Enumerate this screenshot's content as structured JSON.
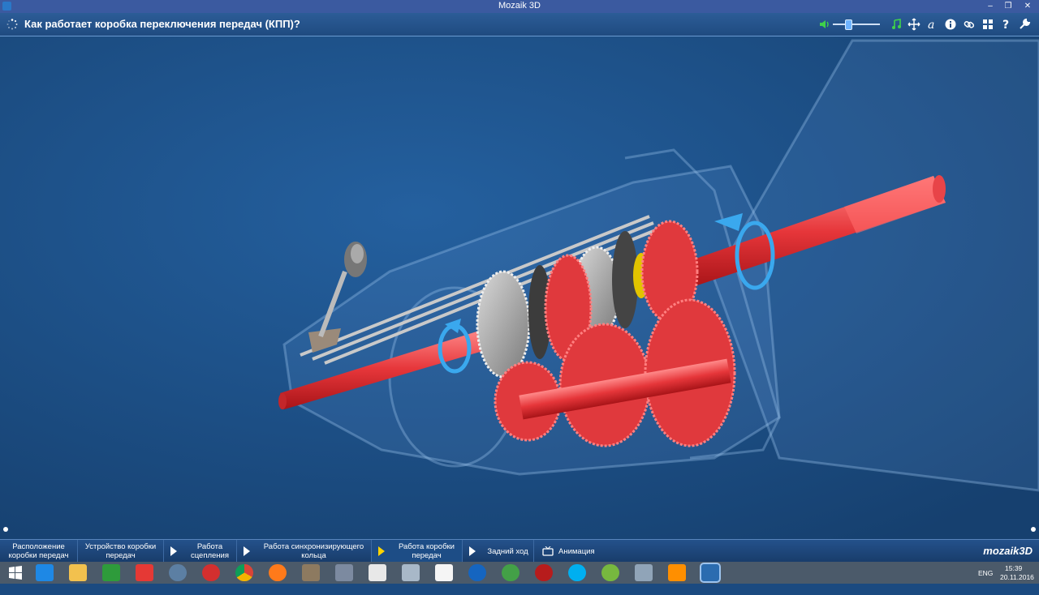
{
  "window": {
    "title": "Mozaik 3D",
    "controls": [
      "–",
      "❐",
      "✕"
    ]
  },
  "header": {
    "title": "Как работает коробка переключения передач (КПП)?",
    "toolbar_icons": [
      "volume-icon",
      "volume-slider",
      "music-icon",
      "move-icon",
      "font-icon",
      "info-icon",
      "link-icon",
      "grid-icon",
      "help-icon",
      "wrench-icon"
    ],
    "accent": "#2c5c97"
  },
  "nav": {
    "items": [
      {
        "label": "Расположение коробки передач",
        "active": false
      },
      {
        "label": "Устройство коробки передач",
        "active": false
      },
      {
        "label": "Работа сцепления",
        "active": false
      },
      {
        "label": "Работа синхронизирующего кольца",
        "active": false
      },
      {
        "label": "Работа коробки передач",
        "active": true
      },
      {
        "label": "Задний ход",
        "active": false
      },
      {
        "label": "Анимация",
        "active": false
      }
    ],
    "brand": "mozaik3D"
  },
  "taskbar": {
    "icons": [
      "windows-start-icon",
      "ie-icon",
      "explorer-icon",
      "store-icon",
      "yandex-icon",
      "cortana-icon",
      "yandex-browser-icon",
      "chrome-icon",
      "firefox-icon",
      "paint-icon",
      "mozaik-icon",
      "notepad-icon",
      "calculator-icon",
      "calendar-icon",
      "media-icon",
      "globe-icon",
      "settings-icon",
      "skype-icon",
      "utorrent-icon",
      "screen-icon",
      "vlc-icon",
      "mozaik3d-active-icon"
    ],
    "lang": "ENG",
    "time": "15:39",
    "date": "20.11.2016"
  }
}
